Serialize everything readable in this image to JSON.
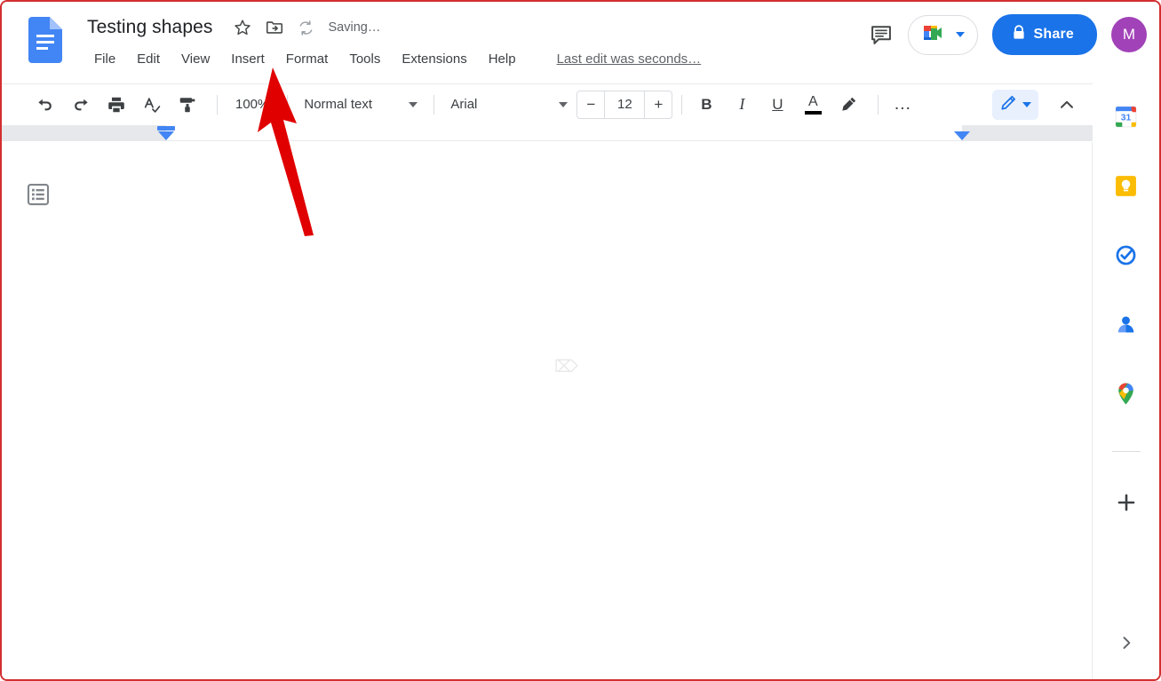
{
  "header": {
    "logo_icon": "google-docs-icon",
    "doc_title": "Testing shapes",
    "star_icon": "star-outline-icon",
    "move_folder_icon": "move-to-folder-icon",
    "sync_icon": "sync-icon",
    "save_status": "Saving…",
    "menus": [
      {
        "label": "File"
      },
      {
        "label": "Edit"
      },
      {
        "label": "View"
      },
      {
        "label": "Insert"
      },
      {
        "label": "Format"
      },
      {
        "label": "Tools"
      },
      {
        "label": "Extensions"
      },
      {
        "label": "Help"
      }
    ],
    "last_edit": "Last edit was seconds…",
    "comment_icon": "comment-icon",
    "meet_icon": "google-meet-icon",
    "meet_caret_icon": "chevron-down-icon",
    "share_lock_icon": "lock-icon",
    "share_label": "Share",
    "avatar_initial": "M",
    "avatar_color": "#a142b8",
    "share_color": "#1a73e8"
  },
  "toolbar": {
    "undo_icon": "undo-icon",
    "redo_icon": "redo-icon",
    "print_icon": "print-icon",
    "spellcheck_icon": "spellcheck-icon",
    "paint_format_icon": "paint-format-icon",
    "zoom_level": "100%",
    "paragraph_style": "Normal text",
    "font_family": "Arial",
    "font_size": "12",
    "decrease_label": "−",
    "increase_label": "+",
    "bold_label": "B",
    "italic_label": "I",
    "underline_label": "U",
    "text_color_label": "A",
    "text_color_value": "#000000",
    "highlight_icon": "highlight-pen-icon",
    "more_label": "…",
    "edit_mode_icon": "pencil-icon",
    "edit_mode_caret": "chevron-down-icon",
    "collapse_icon": "chevron-up-icon"
  },
  "ruler": {
    "left_indent_marker": "left-indent-marker",
    "right_indent_marker": "right-indent-marker"
  },
  "document": {
    "outline_icon": "document-outline-icon",
    "body_text": "",
    "cursor_icon": "text-cursor-ibeam"
  },
  "sidebar": {
    "items": [
      {
        "name": "google-calendar-icon",
        "label": "Calendar"
      },
      {
        "name": "google-keep-icon",
        "label": "Keep"
      },
      {
        "name": "google-tasks-icon",
        "label": "Tasks"
      },
      {
        "name": "google-contacts-icon",
        "label": "Contacts"
      },
      {
        "name": "google-maps-icon",
        "label": "Maps"
      }
    ],
    "add_on_label": "+",
    "expand_icon": "chevron-right-icon"
  },
  "annotation": {
    "arrow_color": "#e00000",
    "arrow_points_to": "Insert"
  }
}
